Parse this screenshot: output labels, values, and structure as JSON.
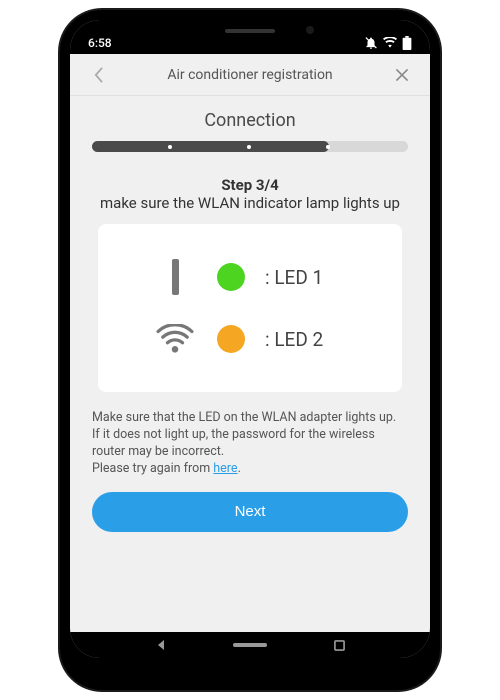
{
  "statusBar": {
    "time": "6:58"
  },
  "header": {
    "title": "Air conditioner registration"
  },
  "section": {
    "title": "Connection"
  },
  "step": {
    "label": "Step 3/4",
    "subtitle": "make sure the WLAN indicator lamp lights up"
  },
  "leds": {
    "led1": ": LED 1",
    "led2": ": LED 2"
  },
  "info": {
    "line1": "Make sure that the LED on the WLAN adapter lights up.",
    "line2": "If it does not light up, the password for the wireless router may be incorrect.",
    "line3_prefix": "Please try again from ",
    "link": "here",
    "line3_suffix": "."
  },
  "buttons": {
    "next": "Next"
  }
}
